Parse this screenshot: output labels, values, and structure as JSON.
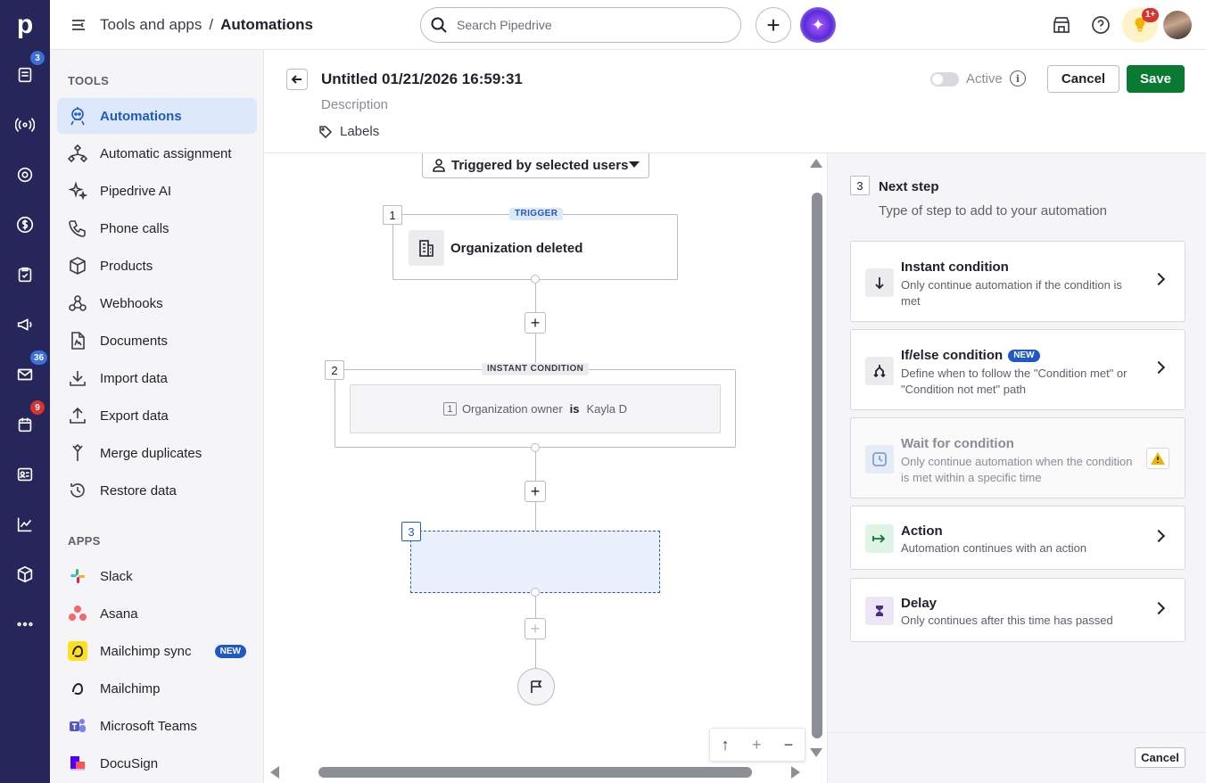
{
  "rail": {
    "logo": "p",
    "badges": {
      "leads": "3",
      "mail": "36",
      "calendar": "9"
    }
  },
  "topbar": {
    "breadcrumb_parent": "Tools and apps",
    "breadcrumb_sep": "/",
    "breadcrumb_current": "Automations",
    "search_placeholder": "Search Pipedrive",
    "add_label": "+",
    "notif_badge": "1+"
  },
  "sidenav": {
    "tools_title": "TOOLS",
    "tools": [
      {
        "label": "Automations",
        "icon": "robot-icon",
        "active": true
      },
      {
        "label": "Automatic assignment",
        "icon": "assignment-icon"
      },
      {
        "label": "Pipedrive AI",
        "icon": "sparkle-icon"
      },
      {
        "label": "Phone calls",
        "icon": "phone-icon"
      },
      {
        "label": "Products",
        "icon": "box-icon"
      },
      {
        "label": "Webhooks",
        "icon": "webhook-icon"
      },
      {
        "label": "Documents",
        "icon": "document-icon"
      },
      {
        "label": "Import data",
        "icon": "download-icon"
      },
      {
        "label": "Export data",
        "icon": "upload-icon"
      },
      {
        "label": "Merge duplicates",
        "icon": "merge-icon"
      },
      {
        "label": "Restore data",
        "icon": "restore-icon"
      }
    ],
    "apps_title": "APPS",
    "apps": [
      {
        "label": "Slack",
        "icon": "slack-icon"
      },
      {
        "label": "Asana",
        "icon": "asana-icon"
      },
      {
        "label": "Mailchimp sync",
        "icon": "mailchimp-icon",
        "badge": "NEW"
      },
      {
        "label": "Mailchimp",
        "icon": "mailchimp-icon"
      },
      {
        "label": "Microsoft Teams",
        "icon": "teams-icon"
      },
      {
        "label": "DocuSign",
        "icon": "docusign-icon"
      }
    ]
  },
  "editor": {
    "title": "Untitled 01/21/2026 16:59:31",
    "description_placeholder": "Description",
    "labels_label": "Labels",
    "active_label": "Active",
    "cancel_label": "Cancel",
    "save_label": "Save"
  },
  "canvas": {
    "trigger_dropdown": "Triggered by selected users",
    "node1": {
      "num": "1",
      "tag": "TRIGGER",
      "title": "Organization deleted"
    },
    "node2": {
      "num": "2",
      "tag": "INSTANT CONDITION",
      "cond_num": "1",
      "cond_field": "Organization owner",
      "cond_op": "is",
      "cond_value": "Kayla D"
    },
    "node3": {
      "num": "3"
    },
    "add_label": "+",
    "zoom": {
      "up": "↑",
      "in": "+",
      "out": "−"
    }
  },
  "panel": {
    "step_num": "3",
    "title": "Next step",
    "subtitle": "Type of step to add to your automation",
    "options": [
      {
        "title": "Instant condition",
        "desc": "Only continue automation if the condition is met",
        "icon": "arrow-down-icon"
      },
      {
        "title": "If/else condition",
        "badge": "NEW",
        "desc": "Define when to follow the \"Condition met\" or \"Condition not met\" path",
        "icon": "branch-icon"
      },
      {
        "title": "Wait for condition",
        "desc": "Only continue automation when the condition is met within a specific time",
        "icon": "clock-icon",
        "disabled": true
      },
      {
        "title": "Action",
        "desc": "Automation continues with an action",
        "icon": "action-arrow-icon"
      },
      {
        "title": "Delay",
        "desc": "Only continues after this time has passed",
        "icon": "hourglass-icon"
      }
    ],
    "cancel_label": "Cancel"
  },
  "colors": {
    "accent": "#2058c4",
    "save": "#0a7a33",
    "rail": "#26265a"
  }
}
